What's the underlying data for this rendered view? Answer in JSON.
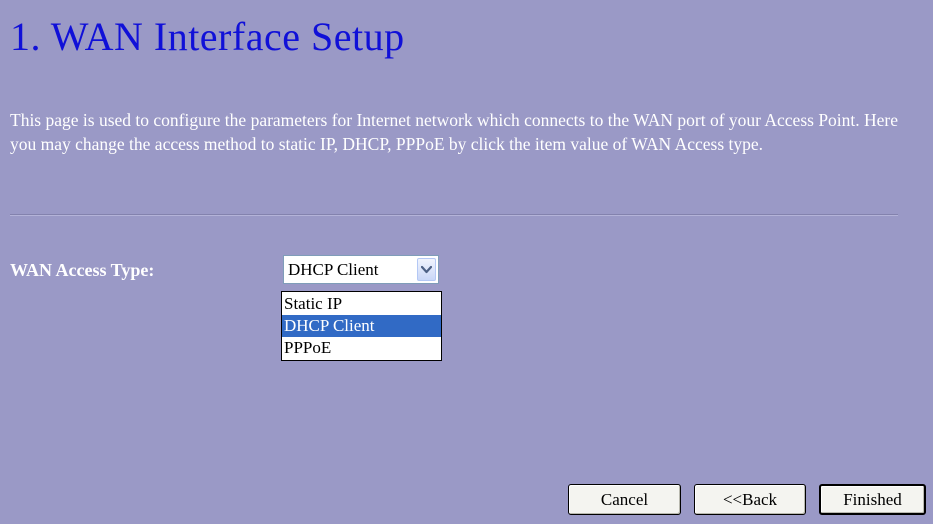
{
  "page": {
    "title": "1. WAN Interface Setup",
    "description": "This page is used to configure the parameters for Internet network which connects to the WAN port of your Access Point. Here you may change the access method to static IP, DHCP, PPPoE by click the item value of WAN Access type."
  },
  "wan_access": {
    "label": "WAN Access Type:",
    "selected": "DHCP Client",
    "options": [
      "Static IP",
      "DHCP Client",
      "PPPoE"
    ],
    "highlighted_index": 1
  },
  "buttons": {
    "cancel": "Cancel",
    "back": "<<Back",
    "finished": "Finished"
  },
  "colors": {
    "background": "#9a99c6",
    "title": "#1010d8",
    "highlight": "#316ac5"
  },
  "icons": {
    "select_arrow": "chevron-down-icon"
  }
}
